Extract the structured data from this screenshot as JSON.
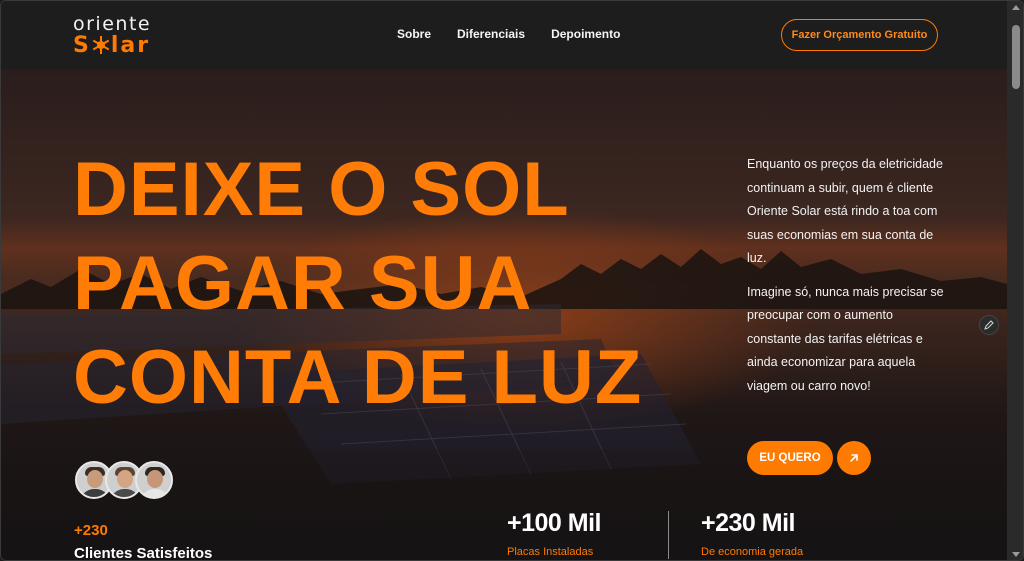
{
  "brand": {
    "logo_top": "oriente",
    "logo_bottom_left": "S",
    "logo_bottom_right": "lar",
    "accent_color": "#ff7a00"
  },
  "nav": {
    "items": [
      {
        "label": "Sobre"
      },
      {
        "label": "Diferenciais"
      },
      {
        "label": "Depoimento"
      }
    ],
    "cta_label": "Fazer Orçamento Gratuito"
  },
  "hero": {
    "headline_lines": [
      "DEIXE O SOL",
      "PAGAR SUA",
      "CONTA DE LUZ"
    ],
    "paragraph_1": "Enquanto os preços da eletricidade continuam a subir, quem é cliente Oriente Solar está rindo a toa com suas economias em sua conta de luz.",
    "paragraph_2": "Imagine só, nunca mais precisar se preocupar com o aumento constante das tarifas elétricas e ainda economizar para aquela viagem ou carro novo!",
    "cta_label": "EU QUERO",
    "cta_icon": "arrow-up-right-icon",
    "edit_icon": "pencil-icon"
  },
  "stats": {
    "clients_count": "+230",
    "clients_label": "Clientes Satisfeitos",
    "items": [
      {
        "value": "+100 Mil",
        "label": "Placas Instaladas"
      },
      {
        "value": "+230 Mil",
        "label": "De economia gerada"
      }
    ]
  }
}
